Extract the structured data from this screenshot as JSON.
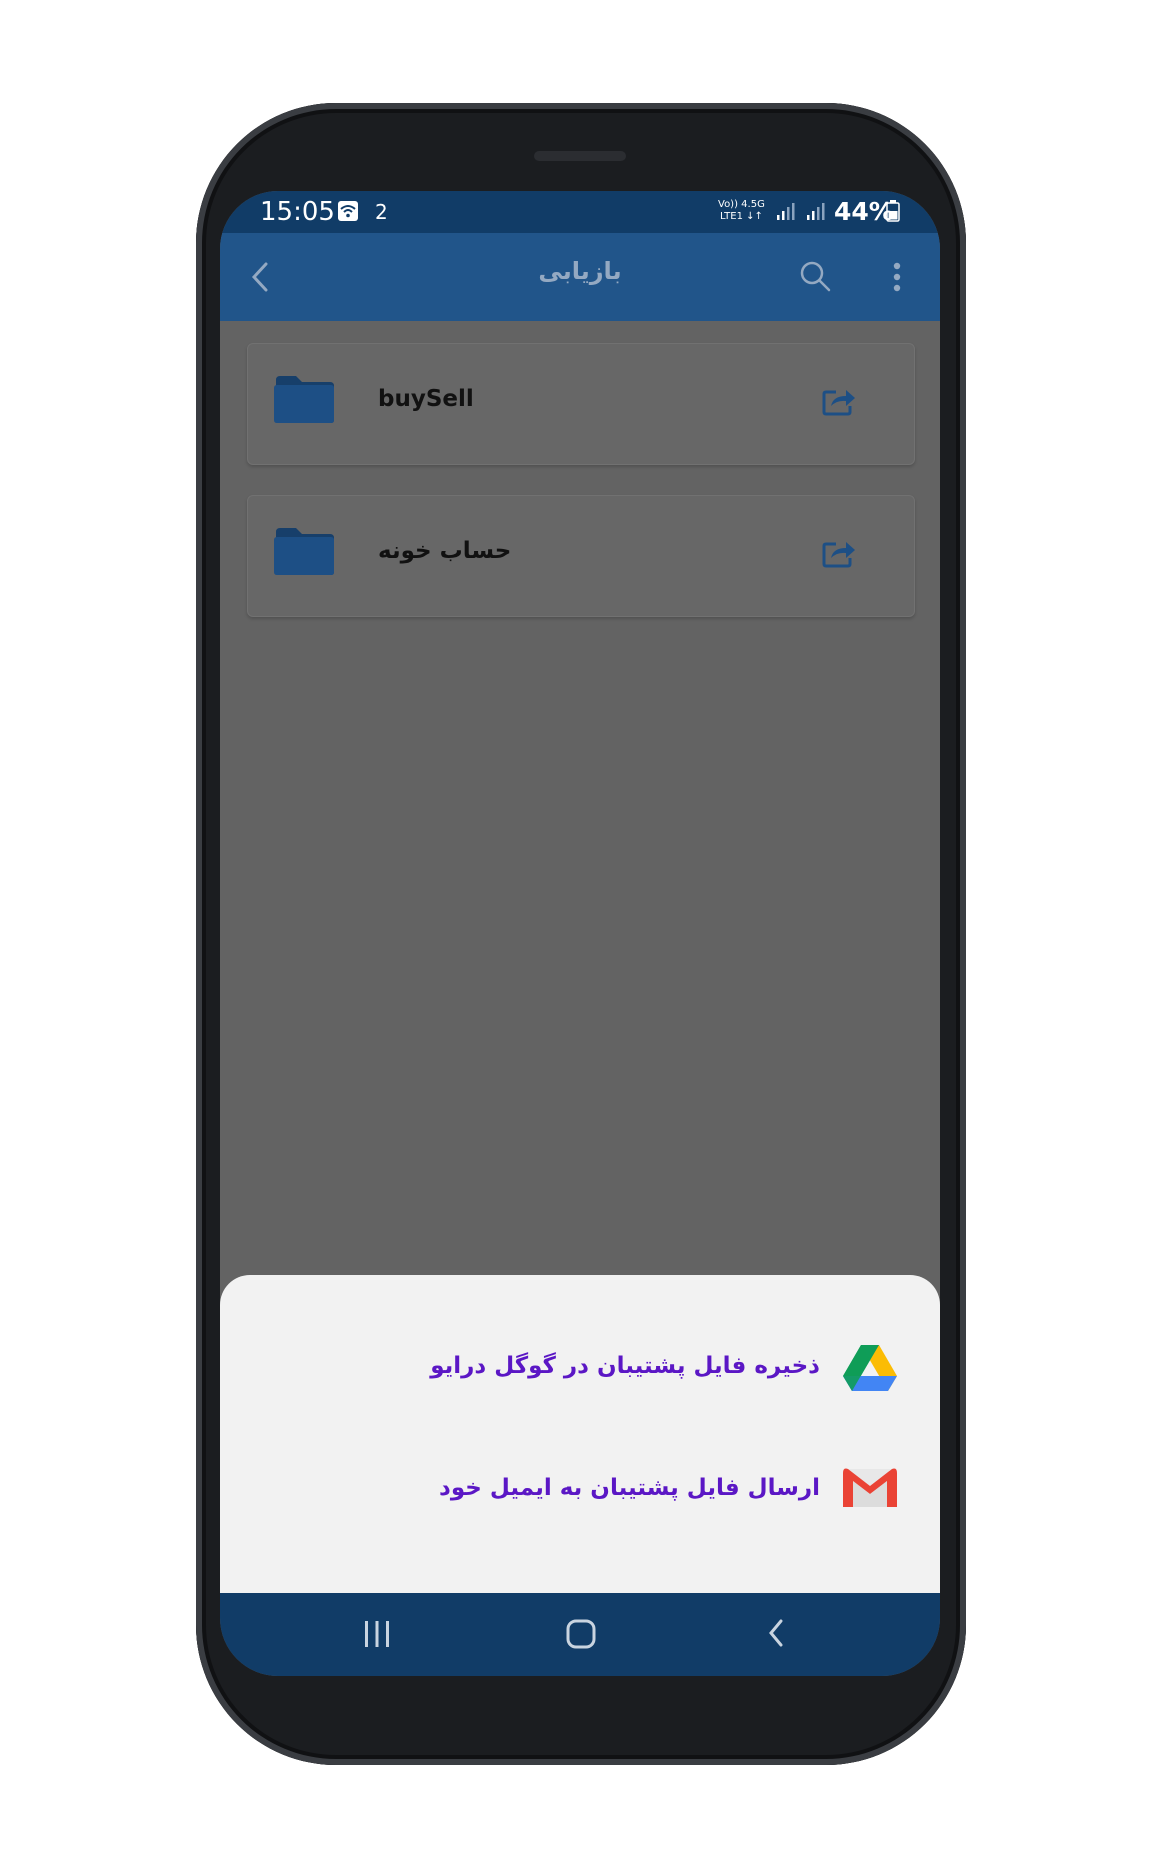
{
  "status_bar": {
    "time": "15:05",
    "notification_count": "2",
    "network_top": "Vo)) 4.5G",
    "network_bottom": "LTE1 ↓↑",
    "battery": "44%"
  },
  "toolbar": {
    "title": "بازیابی",
    "back_icon": "chevron-left-icon",
    "search_icon": "search-icon",
    "menu_icon": "more-vertical-icon"
  },
  "folders": [
    {
      "label": "buySell",
      "icon": "folder-icon",
      "action_icon": "share-icon"
    },
    {
      "label": "حساب خونه",
      "icon": "folder-icon",
      "action_icon": "share-icon"
    }
  ],
  "bottom_sheet": {
    "items": [
      {
        "label": "ذخیره فایل پشتیبان در گوگل درایو",
        "icon": "google-drive-icon"
      },
      {
        "label": "ارسال فایل پشتیبان به ایمیل خود",
        "icon": "gmail-icon"
      }
    ]
  },
  "navigation": {
    "recents_icon": "recents-icon",
    "home_icon": "home-icon",
    "back_icon": "back-icon"
  },
  "colors": {
    "status_bar": "#113c67",
    "toolbar": "#21558a",
    "folder": "#1d4f85",
    "sheet_text": "#5b17c5",
    "scrim": "#636363"
  }
}
